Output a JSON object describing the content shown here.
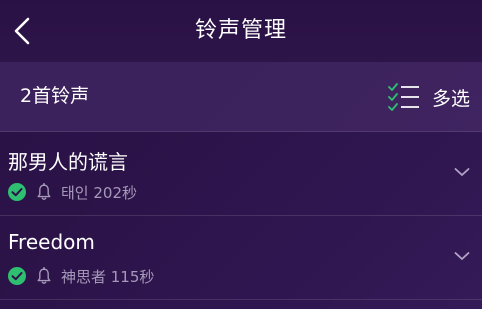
{
  "header": {
    "title": "铃声管理"
  },
  "subheader": {
    "count_label": "2首铃声",
    "multi_select_label": "多选"
  },
  "ringtones": [
    {
      "title": "那男人的谎言",
      "meta": "태인 202秒",
      "status": "checked",
      "status_color": "#2fbf71"
    },
    {
      "title": "Freedom",
      "meta": "神思者 115秒",
      "status": "checked",
      "status_color": "#2fbf71"
    }
  ],
  "colors": {
    "accent": "#2fbf71",
    "background": "#2b1348"
  }
}
